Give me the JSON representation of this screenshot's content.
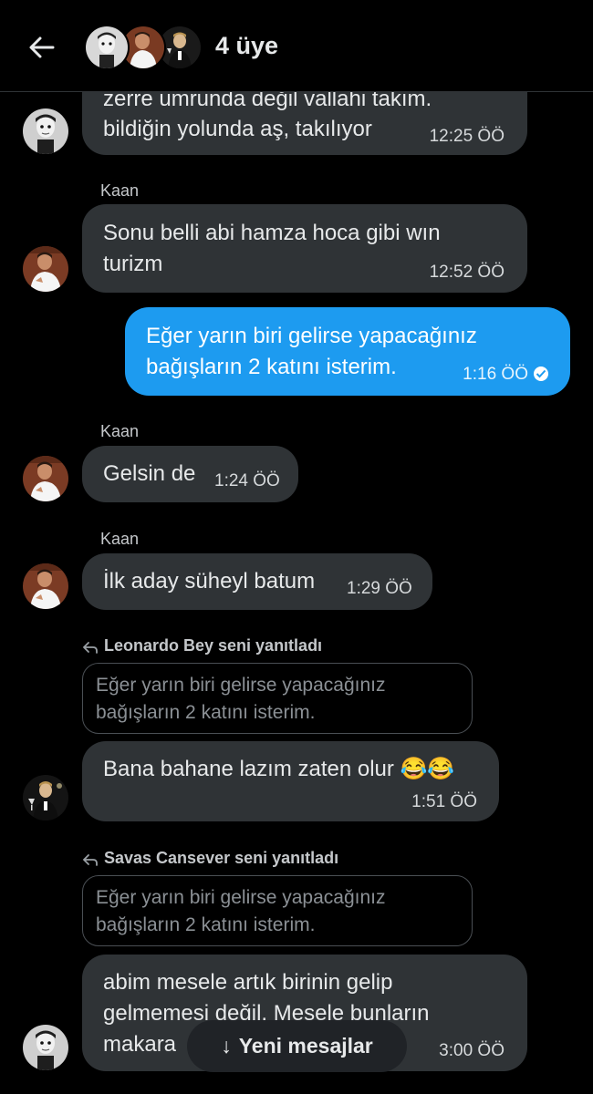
{
  "header": {
    "member_count": "4 üye"
  },
  "messages": [
    {
      "text_lines": [
        "zerre umrunda değil vallahi takım.",
        "bildiğin yolunda aş, takılıyor"
      ],
      "time": "12:25 ÖÖ",
      "sender": "",
      "avatar": "pale-man-avatar"
    },
    {
      "sender": "Kaan",
      "text_lines": [
        "Sonu belli abi hamza hoca gibi wın",
        "turizm"
      ],
      "time": "12:52 ÖÖ",
      "avatar": "kaan-avatar"
    },
    {
      "sent": true,
      "text_lines": [
        "Eğer yarın biri gelirse yapacağınız",
        "bağışların 2 katını isterim."
      ],
      "time": "1:16 ÖÖ"
    },
    {
      "sender": "Kaan",
      "text_lines": [
        "Gelsin de"
      ],
      "time": "1:24 ÖÖ",
      "avatar": "kaan-avatar"
    },
    {
      "sender": "Kaan",
      "text_lines": [
        "İlk aday süheyl batum"
      ],
      "time": "1:29 ÖÖ",
      "avatar": "kaan-avatar"
    },
    {
      "reply_label": "Leonardo Bey seni yanıtladı",
      "quote_lines": [
        "Eğer yarın biri gelirse yapacağınız",
        "bağışların 2 katını isterim."
      ],
      "text_lines": [
        "Bana bahane lazım zaten olur 😂😂"
      ],
      "time": "1:51 ÖÖ",
      "avatar": "leonardo-avatar"
    },
    {
      "reply_label": "Savas Cansever seni yanıtladı",
      "quote_lines": [
        "Eğer yarın biri gelirse yapacağınız",
        "bağışların 2 katını isterim."
      ],
      "text_lines": [
        "abim mesele artık birinin gelip",
        "gelmemesi değil. Mesele bunların",
        "makara"
      ],
      "time": "3:00 ÖÖ",
      "avatar": "pale-man-avatar"
    }
  ],
  "new_messages_button": {
    "arrow": "↓",
    "label": "Yeni mesajlar"
  },
  "colors": {
    "background": "#000000",
    "received_bubble": "#2f3336",
    "sent_bubble": "#1d9bf0",
    "text": "#e7e9ea"
  }
}
